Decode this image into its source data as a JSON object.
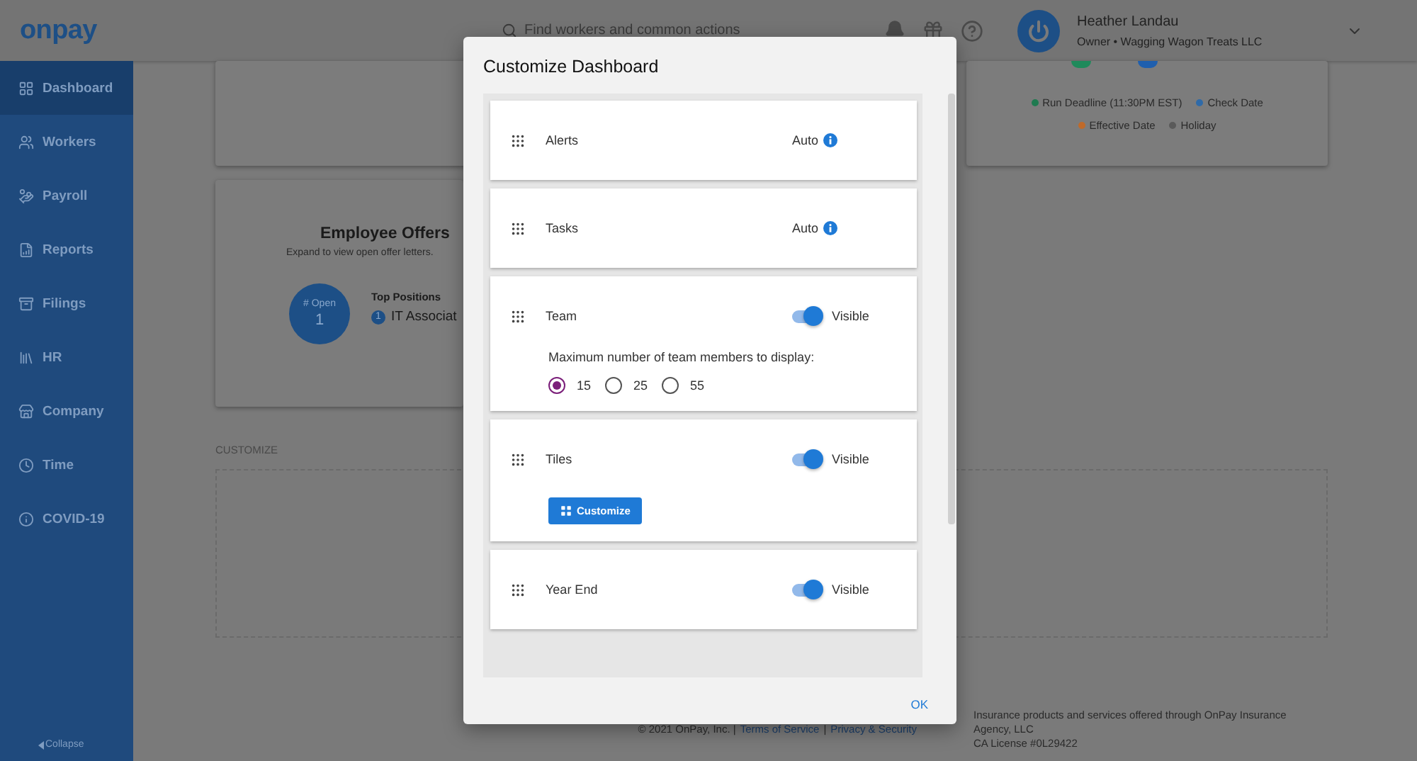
{
  "header": {
    "logo": "onpay",
    "search_placeholder": "Find workers and common actions",
    "user": {
      "name": "Heather Landau",
      "role": "Owner • Wagging Wagon Treats LLC"
    }
  },
  "sidebar": {
    "items": [
      {
        "label": "Dashboard",
        "selected": true
      },
      {
        "label": "Workers",
        "selected": false
      },
      {
        "label": "Payroll",
        "selected": false
      },
      {
        "label": "Reports",
        "selected": false
      },
      {
        "label": "Filings",
        "selected": false
      },
      {
        "label": "HR",
        "selected": false
      },
      {
        "label": "Company",
        "selected": false
      },
      {
        "label": "Time",
        "selected": false
      },
      {
        "label": "COVID-19",
        "selected": false
      }
    ],
    "collapse": "Collapse"
  },
  "dashboard": {
    "markers": [
      {
        "color": "#1f8a5b"
      },
      {
        "color": "#1f5fae"
      }
    ],
    "legend": [
      {
        "label": "Run Deadline (11:30PM EST)",
        "color": "#1f7a50"
      },
      {
        "label": "Check Date",
        "color": "#2f6aa8"
      },
      {
        "label": "Effective Date",
        "color": "#c06a2a"
      },
      {
        "label": "Holiday",
        "color": "#5a5a5a"
      }
    ],
    "offers": {
      "title": "Employee Offers",
      "subtitle": "Expand to view open offer letters.",
      "open_label": "# Open",
      "open_count": "1",
      "positions_title": "Top Positions",
      "positions": [
        {
          "rank": "1",
          "title": "IT Associat"
        }
      ]
    },
    "customize_label": "CUSTOMIZE"
  },
  "footer": {
    "copyright": "© 2021 OnPay, Inc. |",
    "links": [
      "Terms of Service",
      "|",
      "Privacy & Security"
    ],
    "insurance": [
      "Insurance products and services offered through OnPay Insurance",
      "Agency, LLC",
      "CA License #0L29422"
    ]
  },
  "modal": {
    "title": "Customize Dashboard",
    "widgets": [
      {
        "label": "Alerts",
        "kind": "auto",
        "status": "Auto"
      },
      {
        "label": "Tasks",
        "kind": "auto",
        "status": "Auto"
      },
      {
        "label": "Team",
        "kind": "toggle",
        "on": true,
        "status": "Visible",
        "prompt": "Maximum number of team members to display:",
        "options": [
          {
            "label": "15",
            "selected": true
          },
          {
            "label": "25",
            "selected": false
          },
          {
            "label": "55",
            "selected": false
          }
        ]
      },
      {
        "label": "Tiles",
        "kind": "toggle",
        "on": true,
        "status": "Visible",
        "button": "Customize"
      },
      {
        "label": "Year End",
        "kind": "toggle",
        "on": true,
        "status": "Visible"
      }
    ],
    "ok": "OK"
  }
}
